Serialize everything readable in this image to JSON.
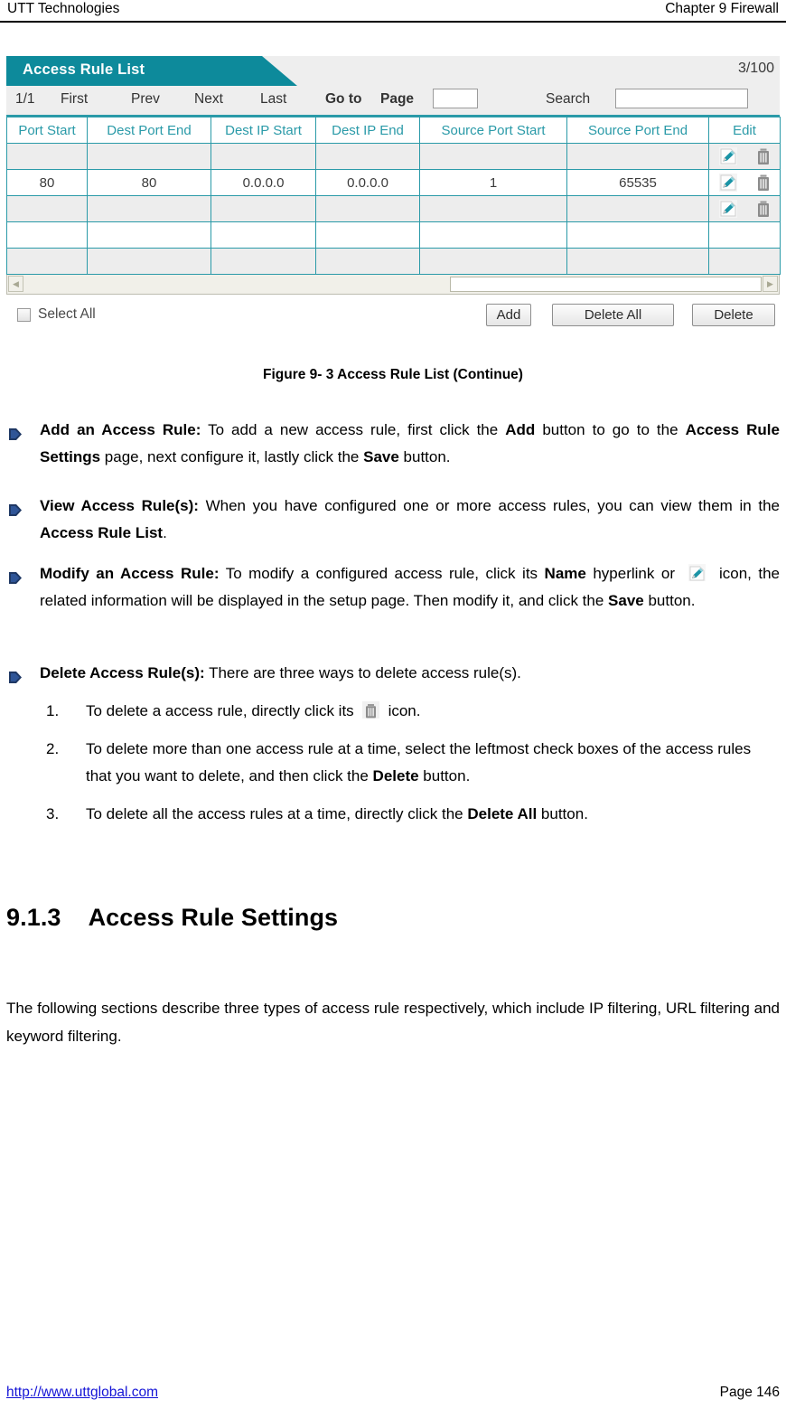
{
  "header": {
    "left": "UTT Technologies",
    "right": "Chapter 9 Firewall"
  },
  "panel": {
    "tab_title": "Access Rule List",
    "count": "3/100",
    "pager": {
      "ratio": "1/1",
      "first": "First",
      "prev": "Prev",
      "next": "Next",
      "last": "Last",
      "goto": "Go to",
      "page": "Page",
      "page_value": "",
      "search_label": "Search",
      "search_value": ""
    },
    "table": {
      "columns": [
        "Port Start",
        "Dest Port End",
        "Dest IP Start",
        "Dest IP End",
        "Source Port Start",
        "Source Port End",
        "Edit"
      ],
      "rows": [
        {
          "cells": [
            "",
            "",
            "",
            "",
            "",
            ""
          ],
          "edit": {
            "pencil": "pencil-icon",
            "trash": "trash-icon"
          },
          "has_icons": true
        },
        {
          "cells": [
            "80",
            "80",
            "0.0.0.0",
            "0.0.0.0",
            "1",
            "65535"
          ],
          "edit": {
            "pencil": "pencil-icon",
            "trash": "trash-icon"
          },
          "has_icons": true
        },
        {
          "cells": [
            "",
            "",
            "",
            "",
            "",
            ""
          ],
          "edit": {
            "pencil": "pencil-icon",
            "trash": "trash-icon"
          },
          "has_icons": true
        },
        {
          "cells": [
            "",
            "",
            "",
            "",
            "",
            ""
          ],
          "edit": {
            "pencil": "",
            "trash": ""
          },
          "has_icons": false
        },
        {
          "cells": [
            "",
            "",
            "",
            "",
            "",
            ""
          ],
          "edit": {
            "pencil": "",
            "trash": ""
          },
          "has_icons": false
        }
      ]
    },
    "scrollbar": {
      "left_arrow": "◀",
      "right_arrow": "▶"
    },
    "actions": {
      "select_all": "Select All",
      "add": "Add",
      "delete_all": "Delete All",
      "delete": "Delete"
    }
  },
  "figure_caption": "Figure 9- 3 Access Rule List (Continue)",
  "bullets": [
    {
      "title": "Add an Access Rule:",
      "parts": [
        {
          "t": " To add a new access rule, first click the ",
          "b": false
        },
        {
          "t": "Add",
          "b": true
        },
        {
          "t": " button to go to the ",
          "b": false
        },
        {
          "t": "Access Rule Settings",
          "b": true
        },
        {
          "t": " page, next configure it, lastly click the ",
          "b": false
        },
        {
          "t": "Save",
          "b": true
        },
        {
          "t": " button.",
          "b": false
        }
      ]
    },
    {
      "title": "View Access Rule(s):",
      "parts": [
        {
          "t": " When you have configured one or more access rules, you can view them in the ",
          "b": false
        },
        {
          "t": "Access Rule List",
          "b": true
        },
        {
          "t": ".",
          "b": false
        }
      ]
    },
    {
      "title": "Modify an Access Rule:",
      "parts": [
        {
          "t": " To modify a configured access rule, click its ",
          "b": false
        },
        {
          "t": "Name",
          "b": true
        },
        {
          "t": " hyperlink or ",
          "b": false
        },
        {
          "t": "[pencil-icon]",
          "b": false,
          "icon": "pencil-icon"
        },
        {
          "t": " icon, the related information will be displayed in the setup page. Then modify it, and click the ",
          "b": false
        },
        {
          "t": "Save",
          "b": true
        },
        {
          "t": " button.",
          "b": false
        }
      ]
    },
    {
      "title": "Delete Access Rule(s):",
      "parts": [
        {
          "t": " There are three ways to delete access rule(s).",
          "b": false
        }
      ]
    }
  ],
  "numbered_list": [
    {
      "num": "1.",
      "parts": [
        {
          "t": "To delete a access rule, directly click its ",
          "b": false
        },
        {
          "t": "[trash-icon]",
          "b": false,
          "icon": "trash-icon"
        },
        {
          "t": " icon.",
          "b": false
        }
      ]
    },
    {
      "num": "2.",
      "parts": [
        {
          "t": "To delete more than one access rule at a time, select the leftmost check boxes of the access rules that you want to delete, and then click the ",
          "b": false
        },
        {
          "t": "Delete",
          "b": true
        },
        {
          "t": " button.",
          "b": false
        }
      ]
    },
    {
      "num": "3.",
      "parts": [
        {
          "t": "To delete all the access rules at a time, directly click the ",
          "b": false
        },
        {
          "t": "Delete All",
          "b": true
        },
        {
          "t": " button.",
          "b": false
        }
      ]
    }
  ],
  "section": {
    "number": "9.1.3",
    "title": "Access Rule Settings",
    "paragraph": "The following sections describe three types of access rule respectively, which include IP filtering, URL filtering and keyword filtering."
  },
  "footer": {
    "url": "http://www.uttglobal.com",
    "page": "Page 146"
  },
  "colors": {
    "teal": "#0d8a9b",
    "table_border": "#2a9aa8",
    "link": "#1414d6",
    "bullet": "#1f3864",
    "row_shade": "#ededed"
  }
}
